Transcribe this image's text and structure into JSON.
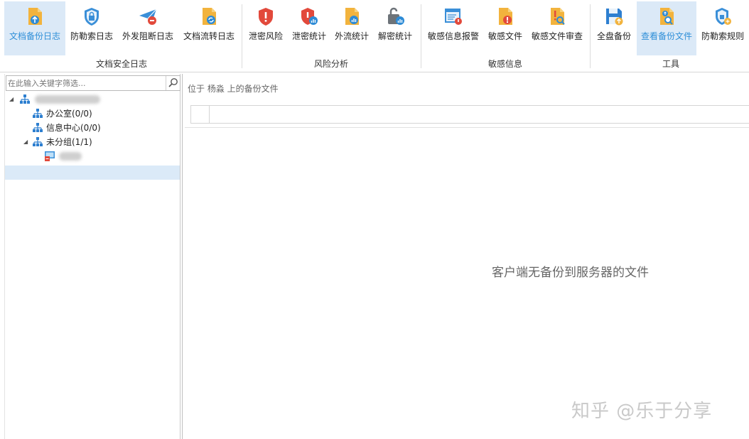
{
  "ribbon": {
    "groups": [
      {
        "label": "文档安全日志",
        "buttons": [
          {
            "label": "文档备份日志",
            "icon": "document-backup-icon",
            "active": true
          },
          {
            "label": "防勒索日志",
            "icon": "shield-lock-icon"
          },
          {
            "label": "外发阻断日志",
            "icon": "paper-plane-block-icon"
          },
          {
            "label": "文档流转日志",
            "icon": "document-transfer-icon"
          }
        ]
      },
      {
        "label": "风险分析",
        "buttons": [
          {
            "label": "泄密风险",
            "icon": "red-shield-alert-icon"
          },
          {
            "label": "泄密统计",
            "icon": "red-shield-stats-icon"
          },
          {
            "label": "外流统计",
            "icon": "document-stats-icon"
          },
          {
            "label": "解密统计",
            "icon": "unlock-stats-icon"
          }
        ]
      },
      {
        "label": "敏感信息",
        "buttons": [
          {
            "label": "敏感信息报警",
            "icon": "sensitive-alarm-icon"
          },
          {
            "label": "敏感文件",
            "icon": "sensitive-file-icon"
          },
          {
            "label": "敏感文件审查",
            "icon": "sensitive-file-review-icon"
          }
        ]
      },
      {
        "label": "工具",
        "buttons": [
          {
            "label": "全盘备份",
            "icon": "disk-backup-icon"
          },
          {
            "label": "查看备份文件",
            "icon": "view-backup-icon",
            "active": true
          },
          {
            "label": "防勒索规则",
            "icon": "ransom-rule-icon"
          }
        ]
      }
    ]
  },
  "search": {
    "placeholder": "在此输入关键字筛选..."
  },
  "tree": {
    "children": [
      {
        "label": "办公室(0/0)"
      },
      {
        "label": "信息中心(0/0)"
      },
      {
        "label": "未分组(1/1)"
      }
    ]
  },
  "content": {
    "location": "位于 杨淼 上的备份文件",
    "empty_message": "客户端无备份到服务器的文件",
    "watermark": "知乎 @乐于分享"
  },
  "colors": {
    "accent": "#2f8fd8",
    "active_bg": "#dbe9f7",
    "selected_row": "#dbeaf8"
  }
}
